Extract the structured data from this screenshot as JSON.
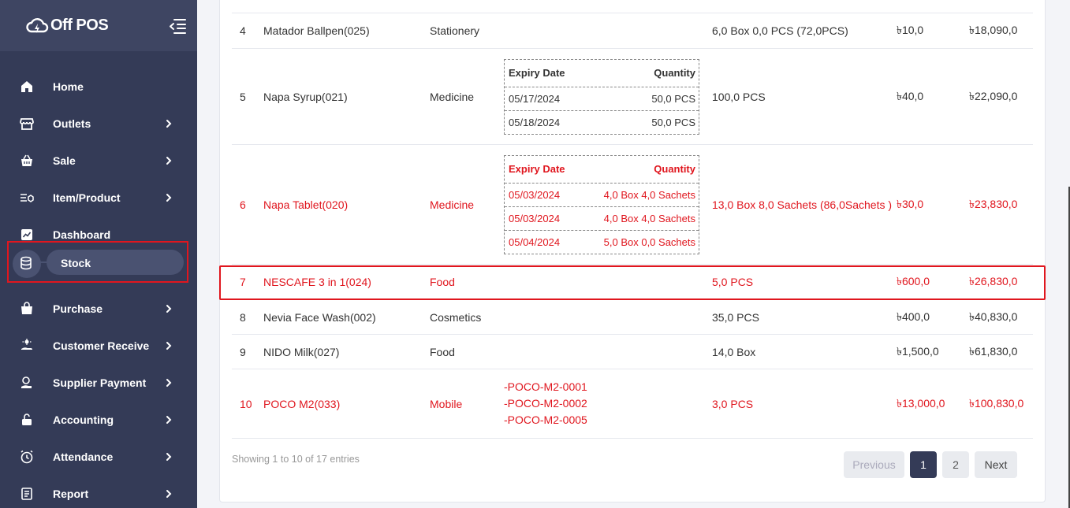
{
  "app": {
    "name": "Off POS"
  },
  "sidebar": {
    "items": [
      {
        "label": "Home",
        "icon": "home-icon",
        "has_sub": false
      },
      {
        "label": "Outlets",
        "icon": "store-icon",
        "has_sub": true
      },
      {
        "label": "Sale",
        "icon": "basket-icon",
        "has_sub": true
      },
      {
        "label": "Item/Product",
        "icon": "product-list-icon",
        "has_sub": true
      },
      {
        "label": "Dashboard",
        "icon": "chart-icon",
        "has_sub": false
      },
      {
        "label": "Stock",
        "icon": "database-icon",
        "has_sub": false,
        "active": true
      },
      {
        "label": "Purchase",
        "icon": "bag-icon",
        "has_sub": true
      },
      {
        "label": "Customer Receive",
        "icon": "hand-coin-icon",
        "has_sub": true
      },
      {
        "label": "Supplier Payment",
        "icon": "payment-icon",
        "has_sub": true
      },
      {
        "label": "Accounting",
        "icon": "lock-icon",
        "has_sub": true
      },
      {
        "label": "Attendance",
        "icon": "clock-icon",
        "has_sub": true
      },
      {
        "label": "Report",
        "icon": "report-icon",
        "has_sub": true
      }
    ]
  },
  "stock_table": {
    "rows": [
      {
        "sl": "4",
        "name": "Matador Ballpen(025)",
        "category": "Stationery",
        "stock": "6,0 Box 0,0 PCS (72,0PCS)",
        "price": "৳10,0",
        "total": "৳18,090,0",
        "alert": false
      },
      {
        "sl": "5",
        "name": "Napa Syrup(021)",
        "category": "Medicine",
        "stock": "100,0 PCS",
        "price": "৳40,0",
        "total": "৳22,090,0",
        "alert": false,
        "expiry": {
          "header_date": "Expiry Date",
          "header_qty": "Quantity",
          "entries": [
            {
              "date": "05/17/2024",
              "qty": "50,0 PCS"
            },
            {
              "date": "05/18/2024",
              "qty": "50,0 PCS"
            }
          ]
        }
      },
      {
        "sl": "6",
        "name": "Napa Tablet(020)",
        "category": "Medicine",
        "stock": "13,0 Box 8,0 Sachets (86,0Sachets )",
        "price": "৳30,0",
        "total": "৳23,830,0",
        "alert": true,
        "expiry": {
          "header_date": "Expiry Date",
          "header_qty": "Quantity",
          "entries": [
            {
              "date": "05/03/2024",
              "qty": "4,0 Box 4,0 Sachets"
            },
            {
              "date": "05/03/2024",
              "qty": "4,0 Box 4,0 Sachets"
            },
            {
              "date": "05/04/2024",
              "qty": "5,0 Box 0,0 Sachets"
            }
          ]
        }
      },
      {
        "sl": "7",
        "name": "NESCAFE 3 in 1(024)",
        "category": "Food",
        "stock": "5,0 PCS",
        "price": "৳600,0",
        "total": "৳26,830,0",
        "alert": true
      },
      {
        "sl": "8",
        "name": "Nevia Face Wash(002)",
        "category": "Cosmetics",
        "stock": "35,0 PCS",
        "price": "৳400,0",
        "total": "৳40,830,0",
        "alert": false
      },
      {
        "sl": "9",
        "name": "NIDO Milk(027)",
        "category": "Food",
        "stock": "14,0 Box",
        "price": "৳1,500,0",
        "total": "৳61,830,0",
        "alert": false
      },
      {
        "sl": "10",
        "name": "POCO M2(033)",
        "category": "Mobile",
        "stock": "3,0 PCS",
        "price": "৳13,000,0",
        "total": "৳100,830,0",
        "alert": true,
        "serials": [
          "-POCO-M2-0001",
          "-POCO-M2-0002",
          "-POCO-M2-0005"
        ]
      }
    ]
  },
  "footer": {
    "showing": "Showing 1 to 10 of 17 entries",
    "pagination": {
      "previous": "Previous",
      "pages": [
        "1",
        "2"
      ],
      "current": "1",
      "next": "Next"
    }
  },
  "colors": {
    "sidebar_bg": "#343b57",
    "alert_red": "#e0161e",
    "active_page": "#343b57"
  }
}
